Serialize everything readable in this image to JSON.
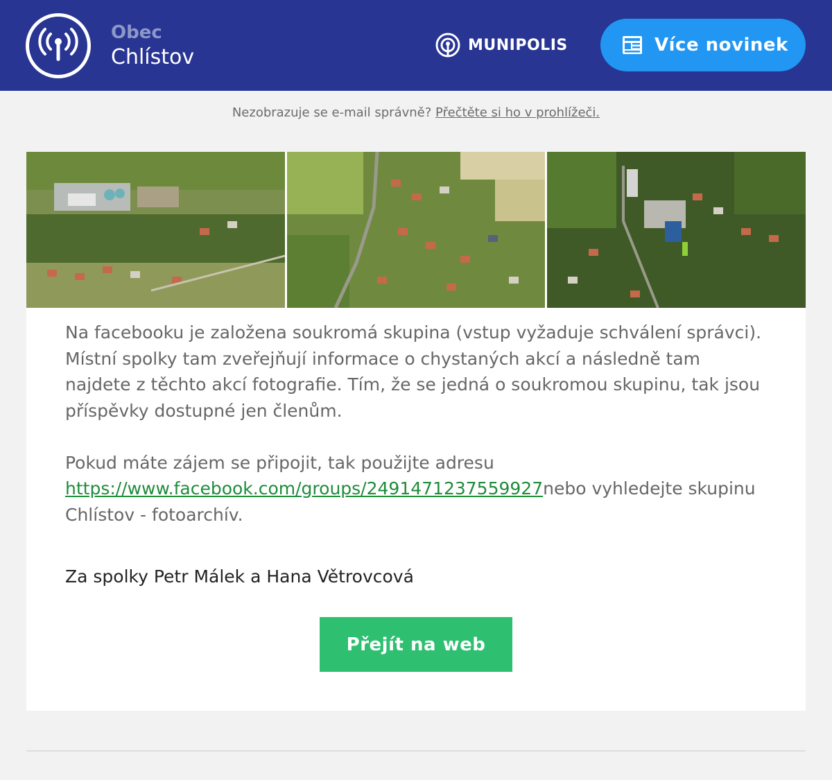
{
  "colors": {
    "header_bg": "#283593",
    "accent_blue": "#2196f3",
    "accent_green": "#2fbf71",
    "link_green": "#1e8c3a"
  },
  "header": {
    "org_type": "Obec",
    "org_name": "Chlístov",
    "brand": "MUNIPOLIS",
    "more_news_label": "Více novinek",
    "logo_icon": "antenna-broadcast-icon",
    "news_icon": "newspaper-icon"
  },
  "preheader": {
    "text": "Nezobrazuje se e-mail správně?",
    "link_text": "Přečtěte si ho v prohlížeči."
  },
  "article": {
    "paragraph1": "Na facebooku je založena soukromá skupina (vstup vyžaduje schválení správci). Místní spolky tam zveřejňují informace o chystaných akcí a následně tam najdete z těchto akcí fotografie. Tím, že se jedná o soukromou skupinu, tak jsou příspěvky dostupné jen členům.",
    "paragraph2_before": "Pokud máte zájem se připojit, tak použijte adresu",
    "paragraph2_link": "https://www.facebook.com/groups/2491471237559927",
    "paragraph2_after": "nebo vyhledejte skupinu Chlístov - fotoarchív.",
    "signature": "Za spolky Petr Málek a Hana Větrovcová",
    "button_label": "Přejít na web"
  }
}
